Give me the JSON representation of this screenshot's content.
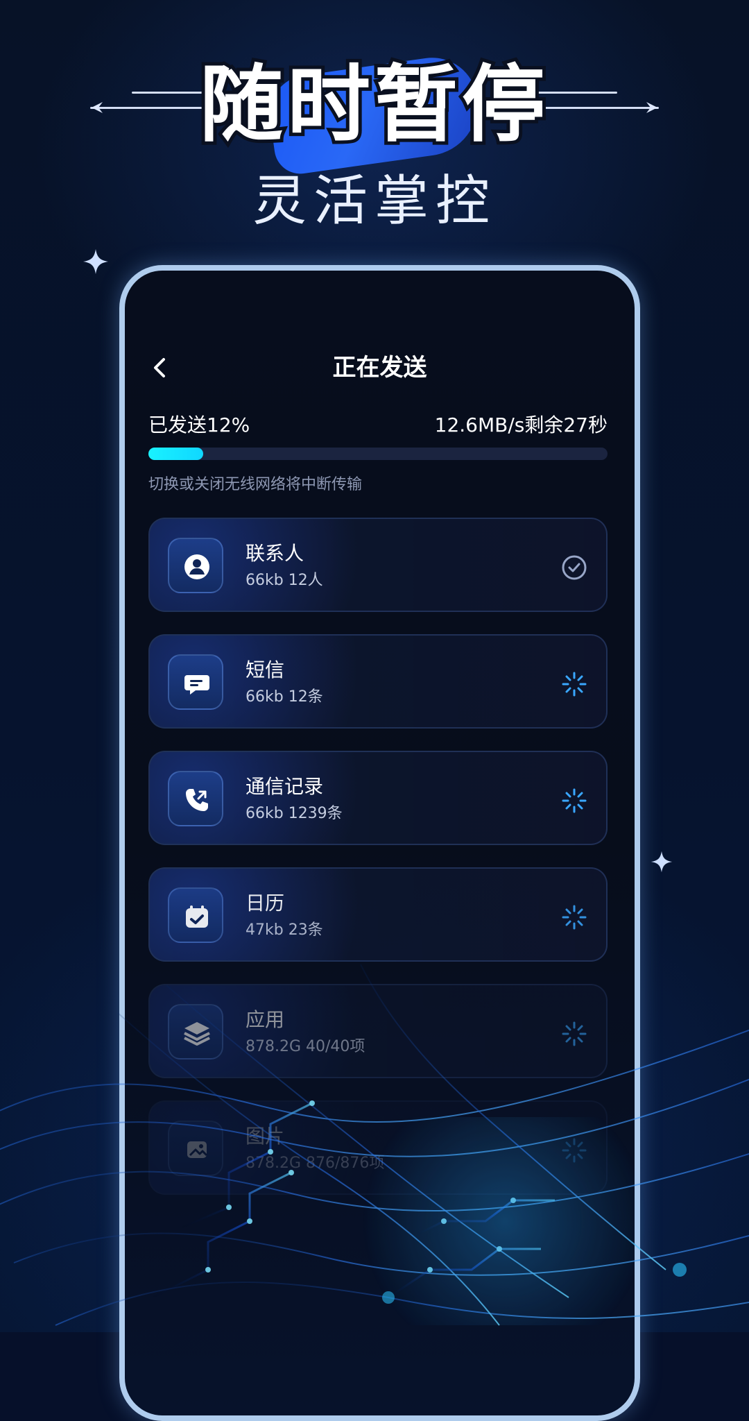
{
  "headline": {
    "title": "随时暂停",
    "subtitle": "灵活掌控"
  },
  "transfer": {
    "screen_title": "正在发送",
    "sent_percent_text": "已发送12%",
    "speed_remaining_text": "12.6MB/s剩余27秒",
    "progress_fraction": 0.12,
    "hint": "切换或关闭无线网络将中断传输"
  },
  "items": [
    {
      "title": "联系人",
      "subtitle": "66kb  12人",
      "icon": "contact-icon",
      "status": "done",
      "status_icon": "check-circle-icon"
    },
    {
      "title": "短信",
      "subtitle": "66kb  12条",
      "icon": "message-icon",
      "status": "loading",
      "status_icon": "spinner-icon"
    },
    {
      "title": "通信记录",
      "subtitle": "66kb  1239条",
      "icon": "call-log-icon",
      "status": "loading",
      "status_icon": "spinner-icon"
    },
    {
      "title": "日历",
      "subtitle": "47kb  23条",
      "icon": "calendar-icon",
      "status": "loading",
      "status_icon": "spinner-icon"
    },
    {
      "title": "应用",
      "subtitle": "878.2G  40/40项",
      "icon": "layers-icon",
      "status": "loading",
      "status_icon": "spinner-icon"
    },
    {
      "title": "图片",
      "subtitle": "878.2G  876/876项",
      "icon": "image-icon",
      "status": "loading",
      "status_icon": "spinner-icon"
    }
  ],
  "colors": {
    "accent": "#17e7ff",
    "background": "#06102a",
    "phone_border": "#bcd8ff",
    "blob": "#2b6cff"
  }
}
